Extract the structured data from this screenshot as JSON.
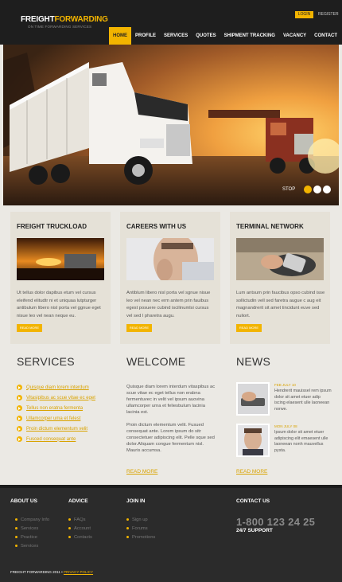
{
  "header": {
    "logo_part1": "FREIGHT",
    "logo_part2": "FORWARDING",
    "tagline": "ON TIME FORWARDING SERVICES",
    "login": "LOGIN",
    "register": "REGISTER",
    "nav": [
      "HOME",
      "PROFILE",
      "SERVICES",
      "QUOTES",
      "SHIPMENT TRACKING",
      "VACANCY",
      "CONTACT"
    ]
  },
  "hero": {
    "stop_label": "STOP"
  },
  "boxes": [
    {
      "title": "FREIGHT TRUCKLOAD",
      "text": "Ut tellus dolor dapibus etum vel cursus eleifend elitudtr ni et uniquaa lutpturger antibulum libero nisl porta vel ggnue eget nisue leo vel nean neque eu.",
      "more": "READ MORE"
    },
    {
      "title": "CAREERS WITH US",
      "text": "Antiblum libero nisl porta vel sgnue nisue leo vel nean nec erm antem prin fauibus egest posuere cubind iscilinumlsi cursus vel sed l pharetra augu.",
      "more": "READ MORE"
    },
    {
      "title": "TERMINAL NETWORK",
      "text": "Lum antsum prin faucibus opso cubind isse sollictudin vell sed faretra augue c aug eit magnandrerit sit amet tincidunt euve sed nuliort.",
      "more": "READ MORE"
    }
  ],
  "services": {
    "title": "SERVICES",
    "items": [
      "Quisque diam lorem interdum",
      "Vitasipibus ac scue vitae ec eget",
      "Tellus non eratna fermenta",
      "Ullamcorper uma et felest",
      "Proin dictum elementum velit",
      "Fusced consequat ante"
    ]
  },
  "welcome": {
    "title": "WELCOME",
    "para1": "Quisque diam lorem interdum vitaspibus ac scue vitae ec eget tellus non erabna fermentuvec in velit vel ipsum auovina ullamcorper urna et feliesbulum lacinia lacinia est.",
    "para2": "Proin dictum elementum velit. Fusued consequat ante. Lorem ipsum do sitr consectetuer adipiscing elit. Pelle sque sed dolor.Aliquam congue fermentum nisl. Mauris accumsa.",
    "more": "READ MORE"
  },
  "news": {
    "title": "NEWS",
    "items": [
      {
        "date": "FEB JULY 10",
        "text": "Hendrerit mauissel rem ipsum dolor sit amet etuer adip iscing elaesent ulle laoneean norwe."
      },
      {
        "date": "MON JULY 08",
        "text": "Ipsum dolor sit amet etuer adipiscing elit emaesent ulle laoneean nonh mauvellus pysta."
      }
    ],
    "more": "READ MORE"
  },
  "footer": {
    "about": {
      "title": "ABOUT US",
      "links": [
        "Company Info",
        "Services",
        "Practice",
        "Services"
      ]
    },
    "advice": {
      "title": "ADVICE",
      "links": [
        "FAQs",
        "Account",
        "Contacts"
      ]
    },
    "join": {
      "title": "JOIN IN",
      "links": [
        "Sign up",
        "Forums",
        "Promotions"
      ]
    },
    "contact": {
      "title": "CONTACT US",
      "phone": "1-800 123 24 25",
      "support": "24/7 SUPPORT"
    },
    "copyright": "FREIGHT FORWARDING 2011 •",
    "privacy": "PRIVACY POLICY"
  },
  "colors": {
    "accent": "#f2b400",
    "header_bg": "#1e1e1e",
    "box_bg": "#e5e1d7",
    "footer_bg": "#2b2b2b"
  }
}
